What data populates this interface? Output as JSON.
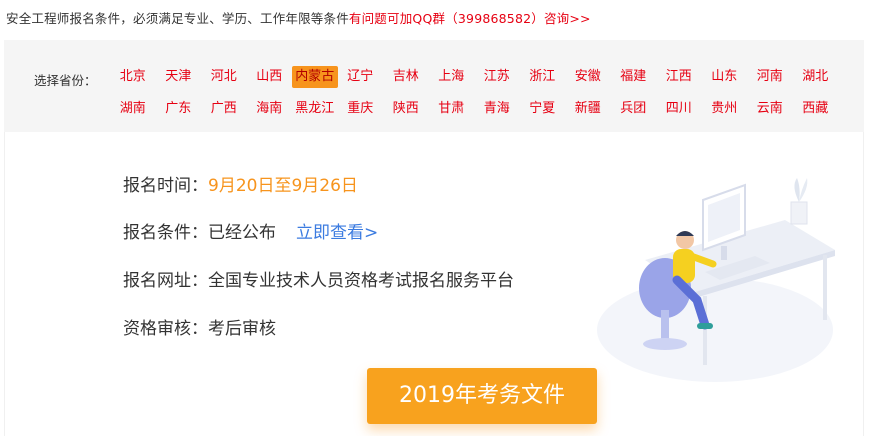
{
  "notice": {
    "text": "安全工程师报名条件，必须满足专业、学历、工作年限等条件",
    "highlight": "有问题可加QQ群（399868582）咨询>>"
  },
  "provinces": {
    "label": "选择省份：",
    "active": "内蒙古",
    "row1": [
      "北京",
      "天津",
      "河北",
      "山西",
      "内蒙古",
      "辽宁",
      "吉林",
      "上海",
      "江苏",
      "浙江",
      "安徽",
      "福建",
      "江西",
      "山东",
      "河南",
      "湖北"
    ],
    "row2": [
      "湖南",
      "广东",
      "广西",
      "海南",
      "黑龙江",
      "重庆",
      "陕西",
      "甘肃",
      "青海",
      "宁夏",
      "新疆",
      "兵团",
      "四川",
      "贵州",
      "云南",
      "西藏"
    ]
  },
  "info": {
    "reg_time_label": "报名时间：",
    "reg_time_value": "9月20日至9月26日",
    "reg_cond_label": "报名条件：",
    "reg_cond_value": "已经公布",
    "reg_cond_link": "立即查看>",
    "reg_site_label": "报名网址：",
    "reg_site_value": "全国专业技术人员资格考试报名服务平台",
    "review_label": "资格审核：",
    "review_value": "考后审核"
  },
  "button": {
    "label": "2019年考务文件"
  },
  "colors": {
    "red": "#e60012",
    "orange": "#f7941d",
    "link": "#3b7be0",
    "button": "#f8a21e"
  },
  "icons": {
    "illustration": "person-at-computer-illustration"
  }
}
